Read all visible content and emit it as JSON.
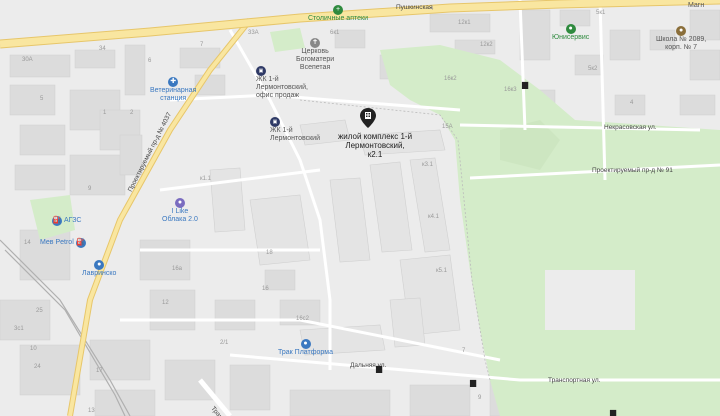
{
  "streets": {
    "proezd_4037": "Проектируемый пр-д № 4037",
    "proezd_91": "Проектируемый пр-д № 91",
    "nekrasovskaya": "Некрасовская ул.",
    "dalnyaya": "Дальняя ул.",
    "transportnaya": "Транспортная ул.",
    "pushkinskaya": "Пушкинская",
    "bottom_partial": "Транс"
  },
  "target": {
    "label_line1": "жилой комплекс 1-й",
    "label_line2": "Лермонтовский,",
    "label_line3": "к2.1"
  },
  "pois": {
    "stolichnye_apteki": "Столичные аптеки",
    "church_line1": "Церковь",
    "church_line2": "Богоматери",
    "church_line3": "Всепетая",
    "jk_office_line1": "ЖК 1-й",
    "jk_office_line2": "Лермонтовский,",
    "jk_office_line3": "офис продаж",
    "jk_line1": "ЖК 1-й",
    "jk_line2": "Лермонтовский",
    "vet_line1": "Ветеринарная",
    "vet_line2": "станция",
    "ilike_line1": "I Like",
    "ilike_line2": "Облака 2.0",
    "ags": "АГЗС",
    "mew_petrol": "Мев Petrol",
    "lavrinsko": "Лавринско",
    "trak": "Трак Платформа",
    "yunservis": "Юнисервис",
    "school_line1": "Школа № 2089,",
    "school_line2": "корп. № 7",
    "magn": "Магн"
  },
  "house_numbers": {
    "n12k1": "12к1",
    "n12k2": "12к2",
    "n16k2": "16к2",
    "n16k3": "16к3",
    "n5k1": "5к1",
    "n5k2": "5к2",
    "n6k1": "6к1",
    "n4": "4",
    "n15A": "15А",
    "n30A": "30А",
    "n33A": "33А",
    "n34": "34",
    "k1_1": "к1.1",
    "k3_1": "к3.1",
    "k4_1": "к4.1",
    "k5_1": "к5.1",
    "n18": "18",
    "n25": "25",
    "n17": "17",
    "n16a": "16а",
    "n1": "1",
    "n6": "6",
    "n7": "7",
    "n9": "9",
    "n10": "10",
    "n5": "5",
    "n2": "2",
    "n24": "24",
    "n3c1": "3с1",
    "n16s2": "16с2",
    "n7b": "7",
    "n9b": "9",
    "n14": "14",
    "n16": "16",
    "n12": "12",
    "n13": "13",
    "n2_1": "2/1",
    "n4_1": "4"
  },
  "colors": {
    "park": "#d4ecc9",
    "road_major": "#f9e6a0",
    "road_major_edge": "#e7c66a",
    "building": "#dcdcdc",
    "poi_blue": "#3a78c0",
    "poi_green": "#2e8a3e",
    "marker": "#222222",
    "railway": "#b0b0b0"
  }
}
